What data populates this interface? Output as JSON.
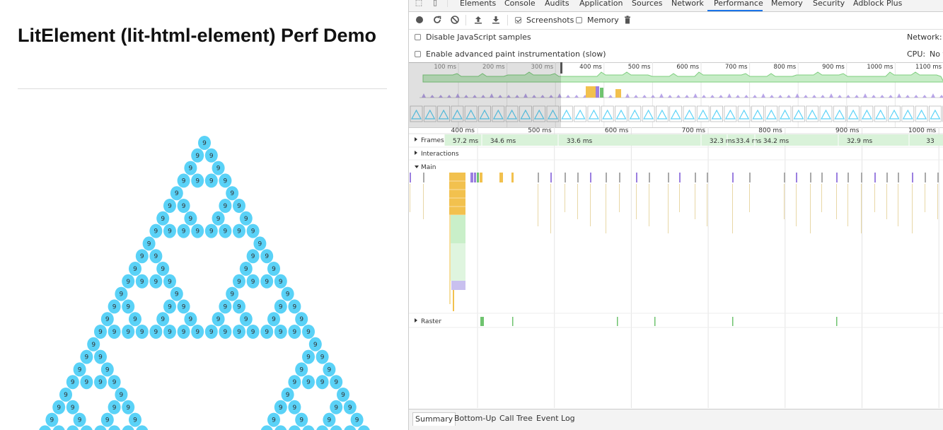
{
  "page": {
    "title": "LitElement (lit-html-element) Perf Demo",
    "node_label": "9",
    "node_color": "#5ad2f7"
  },
  "devtools": {
    "tabs": [
      {
        "label": "Elements",
        "active": false
      },
      {
        "label": "Console",
        "active": false
      },
      {
        "label": "Audits",
        "active": false
      },
      {
        "label": "Application",
        "active": false
      },
      {
        "label": "Sources",
        "active": false
      },
      {
        "label": "Network",
        "active": false
      },
      {
        "label": "Performance",
        "active": true
      },
      {
        "label": "Memory",
        "active": false
      },
      {
        "label": "Security",
        "active": false
      },
      {
        "label": "Adblock Plus",
        "active": false
      }
    ],
    "toolbar": {
      "record_icon": "record-icon",
      "reload_icon": "reload-icon",
      "clear_icon": "clear-icon",
      "upload_icon": "upload-icon",
      "download_icon": "download-icon",
      "screenshots_label": "Screenshots",
      "screenshots_checked": true,
      "memory_label": "Memory",
      "memory_checked": false,
      "trash_icon": "trash-icon"
    },
    "settings": {
      "disable_js_samples": "Disable JavaScript samples",
      "advanced_paint": "Enable advanced paint instrumentation (slow)",
      "network_label": "Network:",
      "cpu_label": "CPU:",
      "cpu_value": "No t"
    },
    "overview_ticks": [
      "100 ms",
      "200 ms",
      "300 ms",
      "400 ms",
      "500 ms",
      "600 ms",
      "700 ms",
      "800 ms",
      "900 ms",
      "1000 ms",
      "1100 ms"
    ],
    "flame_ticks": [
      "400 ms",
      "500 ms",
      "600 ms",
      "700 ms",
      "800 ms",
      "900 ms",
      "1000 ms"
    ],
    "frames": [
      "57.2 ms",
      "34.6 ms",
      "33.6 ms",
      "32.3 ms",
      "33.4 ms",
      "34.2 ms",
      "32.9 ms",
      "33"
    ],
    "tracks": {
      "frames": "Frames",
      "interactions": "Interactions",
      "main": "Main",
      "raster": "Raster"
    },
    "bottom_tabs": [
      {
        "label": "Summary",
        "active": true
      },
      {
        "label": "Bottom-Up",
        "active": false
      },
      {
        "label": "Call Tree",
        "active": false
      },
      {
        "label": "Event Log",
        "active": false
      }
    ],
    "colors": {
      "scripting": "#f2c14e",
      "rendering": "#9b7fe0",
      "painting": "#6fc36f",
      "fps": "#c7ecc7",
      "frame_bg": "#d9f2d9",
      "accent": "#1a73e8"
    }
  }
}
